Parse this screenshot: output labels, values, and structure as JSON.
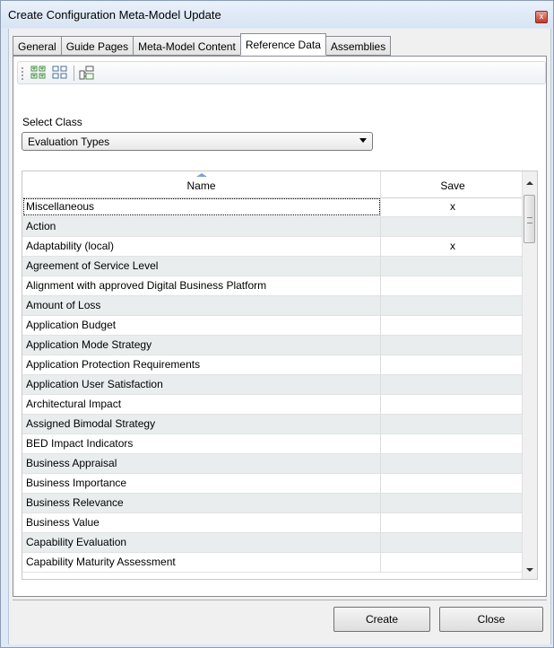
{
  "window": {
    "title": "Create Configuration Meta-Model Update",
    "close_glyph": "x"
  },
  "tabs": [
    {
      "label": "General"
    },
    {
      "label": "Guide Pages"
    },
    {
      "label": "Meta-Model Content"
    },
    {
      "label": "Reference Data",
      "active": true
    },
    {
      "label": "Assemblies"
    }
  ],
  "toolbar": {
    "buttons": [
      "expand-all-icon",
      "collapse-all-icon",
      "hierarchy-icon"
    ]
  },
  "select_class": {
    "label": "Select Class",
    "value": "Evaluation Types"
  },
  "grid": {
    "columns": [
      "Name",
      "Save"
    ],
    "rows": [
      {
        "name": "Miscellaneous",
        "save": "x"
      },
      {
        "name": "Action",
        "save": ""
      },
      {
        "name": "Adaptability (local)",
        "save": "x"
      },
      {
        "name": "Agreement of Service Level",
        "save": ""
      },
      {
        "name": "Alignment with approved Digital Business Platform",
        "save": ""
      },
      {
        "name": "Amount of Loss",
        "save": ""
      },
      {
        "name": "Application Budget",
        "save": ""
      },
      {
        "name": "Application Mode Strategy",
        "save": ""
      },
      {
        "name": "Application Protection Requirements",
        "save": ""
      },
      {
        "name": "Application User Satisfaction",
        "save": ""
      },
      {
        "name": "Architectural Impact",
        "save": ""
      },
      {
        "name": "Assigned Bimodal Strategy",
        "save": ""
      },
      {
        "name": "BED Impact Indicators",
        "save": ""
      },
      {
        "name": "Business Appraisal",
        "save": ""
      },
      {
        "name": "Business Importance",
        "save": ""
      },
      {
        "name": "Business Relevance",
        "save": ""
      },
      {
        "name": "Business Value",
        "save": ""
      },
      {
        "name": "Capability Evaluation",
        "save": ""
      },
      {
        "name": "Capability Maturity Assessment",
        "save": ""
      }
    ]
  },
  "buttons": {
    "create": "Create",
    "close": "Close"
  },
  "colors": {
    "window_frame": "#dfe9f5",
    "alt_row": "#e9edee",
    "sort_arrow": "#7aa3cf"
  }
}
